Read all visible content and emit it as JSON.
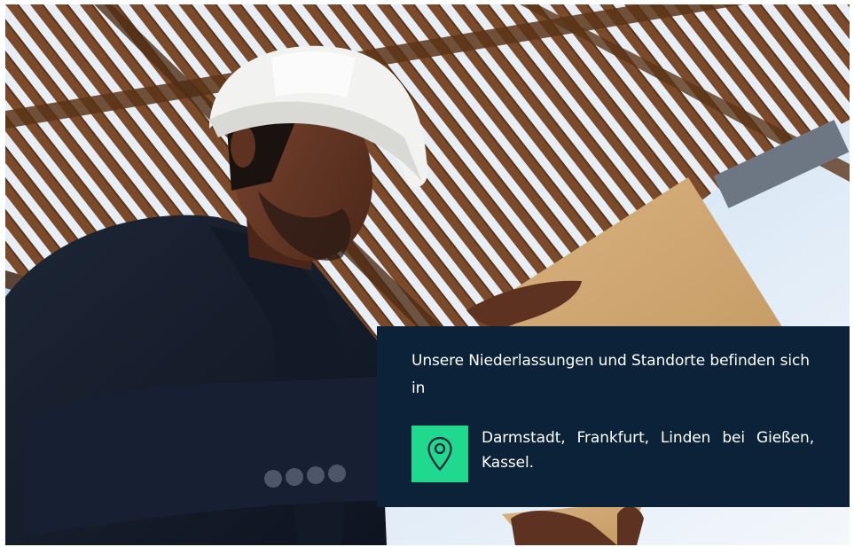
{
  "photo": {
    "alt": "Mann mit weißem Schutzhelm liest Dokumente unter einer Holzpergola",
    "icon": "construction-worker-photo"
  },
  "card": {
    "heading": "Unsere Niederlassungen und Standorte befinden sich in",
    "locations": "Darmstadt, Frankfurt, Linden bei Gießen, Kassel.",
    "icon": "location-pin-icon"
  },
  "colors": {
    "card_background": "#0c2238",
    "pin_background": "#1ed98e",
    "text": "#ffffff"
  }
}
